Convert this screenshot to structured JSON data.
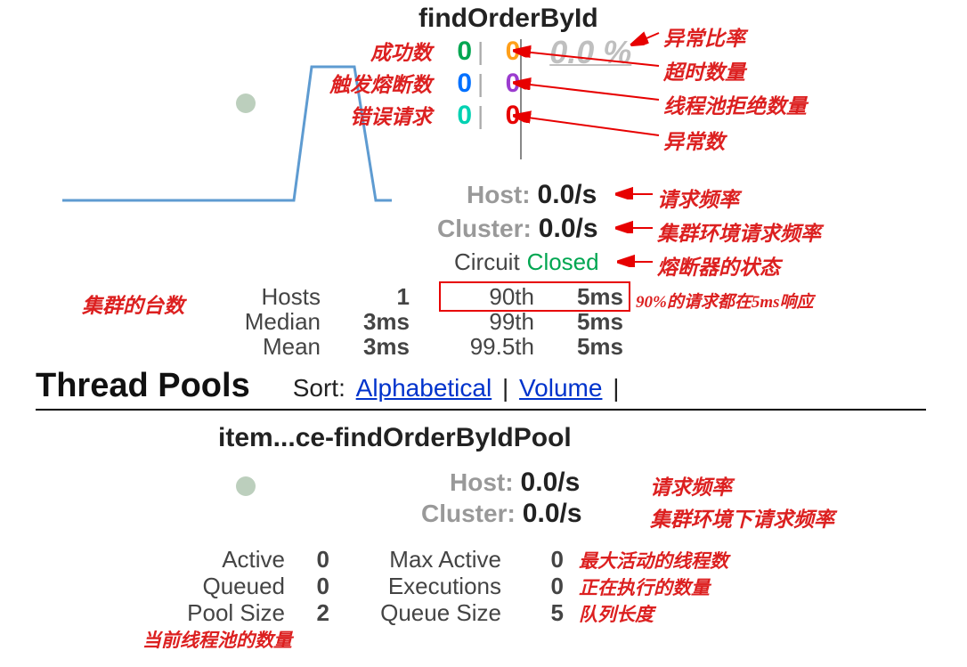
{
  "command": {
    "title": "findOrderById",
    "anns": {
      "success": "成功数",
      "short_circuited": "触发熔断数",
      "bad_request": "错误请求",
      "error_rate": "异常比率",
      "timeout": "超时数量",
      "rejected": "线程池拒绝数量",
      "failure": "异常数"
    },
    "vals": {
      "success": "0",
      "short_circuited": "0",
      "bad_request": "0",
      "timeout": "0",
      "rejected": "0",
      "failure": "0"
    },
    "error_pct": "0.0 %",
    "host": {
      "label": "Host:",
      "value": "0.0/s",
      "ann": "请求频率"
    },
    "cluster": {
      "label": "Cluster:",
      "value": "0.0/s",
      "ann": "集群环境请求频率"
    },
    "circuit": {
      "label": "Circuit",
      "value": "Closed",
      "ann": "熔断器的状态"
    },
    "cluster_count_ann": "集群的台数",
    "stats_left": [
      {
        "label": "Hosts",
        "value": "1"
      },
      {
        "label": "Median",
        "value": "3ms"
      },
      {
        "label": "Mean",
        "value": "3ms"
      }
    ],
    "stats_right": [
      {
        "label": "90th",
        "value": "5ms"
      },
      {
        "label": "99th",
        "value": "5ms"
      },
      {
        "label": "99.5th",
        "value": "5ms"
      }
    ],
    "p90_ann": "90%的请求都在5ms响应"
  },
  "tp_header": {
    "title": "Thread Pools",
    "sort_label": "Sort:",
    "link1": "Alphabetical",
    "link2": "Volume"
  },
  "pool": {
    "name": "item...ce-findOrderByIdPool",
    "host": {
      "label": "Host:",
      "value": "0.0/s",
      "ann": "请求频率"
    },
    "cluster": {
      "label": "Cluster:",
      "value": "0.0/s",
      "ann": "集群环境下请求频率"
    },
    "stats_left": [
      {
        "label": "Active",
        "value": "0"
      },
      {
        "label": "Queued",
        "value": "0"
      },
      {
        "label": "Pool Size",
        "value": "2"
      }
    ],
    "stats_right": [
      {
        "label": "Max Active",
        "value": "0",
        "ann": "最大活动的线程数"
      },
      {
        "label": "Executions",
        "value": "0",
        "ann": "正在执行的数量"
      },
      {
        "label": "Queue Size",
        "value": "5",
        "ann": "队列长度"
      }
    ],
    "pool_size_ann": "当前线程池的数量"
  }
}
